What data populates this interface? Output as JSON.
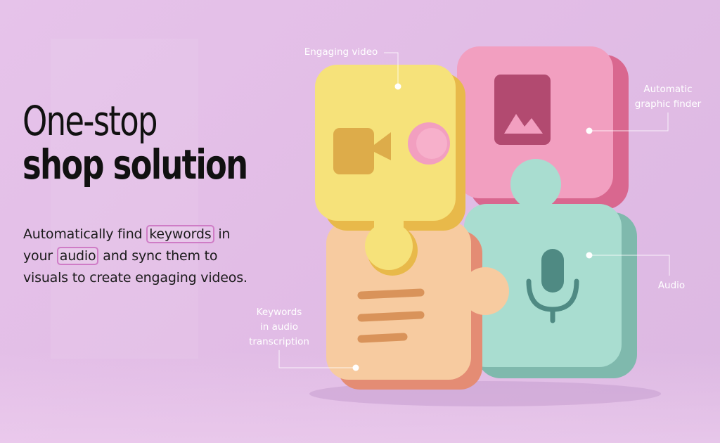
{
  "headline": {
    "line1": "One-stop",
    "line2": "shop solution"
  },
  "description": {
    "part1": "Automatically find ",
    "keyword1": "keywords",
    "part2": " in your ",
    "keyword2": "audio",
    "part3": " and sync them to visuals to create engaging videos."
  },
  "callouts": {
    "engaging_video": "Engaging video",
    "graphic_finder_line1": "Automatic",
    "graphic_finder_line2": "graphic finder",
    "audio": "Audio",
    "keywords_line1": "Keywords",
    "keywords_line2": "in audio",
    "keywords_line3": "transcription"
  },
  "puzzle_pieces": [
    {
      "name": "video",
      "color": "#f6e27a",
      "icon": "video-camera-icon"
    },
    {
      "name": "graphic",
      "color": "#f29fc0",
      "icon": "image-icon"
    },
    {
      "name": "keywords",
      "color": "#f7cba0",
      "icon": "text-lines-icon"
    },
    {
      "name": "audio",
      "color": "#a9ddd0",
      "icon": "microphone-icon"
    }
  ],
  "colors": {
    "background": "#e3c0e8",
    "keyword_highlight": "#cf7cc6",
    "text": "#111111",
    "callout_text": "#ffffff"
  }
}
